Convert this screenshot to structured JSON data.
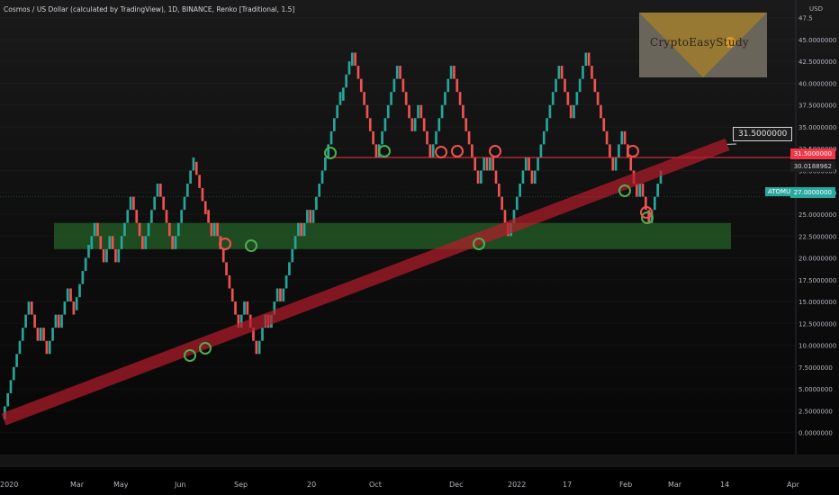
{
  "header": {
    "title": "Cosmos / US Dollar (calculated by TradingView), 1D, BINANCE, Renko [Traditional, 1.5]"
  },
  "logo": {
    "text": "CryptoEasyStudy"
  },
  "axis": {
    "currency": "USD"
  },
  "badges": {
    "level_price": "31.5000000",
    "last_price": "30.0188962",
    "symbol": "ATOMUSD",
    "symbol_price": "27.0000000"
  },
  "callout": {
    "text": "31.5000000"
  },
  "colors": {
    "up": "#26a69a",
    "down": "#ef5350",
    "zone": "#2e7d32",
    "trendline": "#b71c2b",
    "level": "#f23645",
    "circle_green": "#4caf50",
    "circle_red": "#ef5350"
  },
  "chart_data": {
    "type": "renko",
    "symbol": "ATOMUSD",
    "box_size": 1.5,
    "y_ticks": [
      0,
      2.5,
      5,
      7.5,
      10,
      12.5,
      15,
      17.5,
      20,
      22.5,
      25,
      27.5,
      30,
      32.5,
      35,
      37.5,
      40,
      42.5,
      45,
      47.5
    ],
    "y_tick_labels": [
      "0.0000000",
      "2.5000000",
      "5.0000000",
      "7.5000000",
      "10.0000000",
      "12.5000000",
      "15.0000000",
      "17.5000000",
      "20.0000000",
      "22.5000000",
      "25.0000000",
      "27.5000000",
      "30.0000000",
      "32.5000000",
      "35.0000000",
      "37.5000000",
      "40.0000000",
      "42.5000000",
      "45.0000000",
      "47.5"
    ],
    "ylim": [
      -2,
      48.5
    ],
    "x_labels": [
      "2020",
      "Mar",
      "May",
      "Jun",
      "Sep",
      "20",
      "Oct",
      "Dec",
      "2022",
      "17",
      "Feb",
      "Mar",
      "14",
      "Apr"
    ],
    "path": [
      1.5,
      15,
      10.5,
      12,
      9,
      13.5,
      12,
      16.5,
      14,
      21,
      22.5,
      24,
      19.5,
      21,
      22.5,
      19.5,
      24,
      27,
      25.5,
      21,
      22.5,
      27,
      28.5,
      25.5,
      21,
      22.5,
      28.5,
      31,
      25.5,
      22.5,
      24,
      18,
      16.5,
      13.5,
      12,
      15,
      10.5,
      9,
      10.5,
      13.5,
      12,
      16.5,
      15,
      19.5,
      21,
      24,
      22.5,
      25.5,
      24,
      28.5,
      33,
      36,
      38,
      42,
      43.5,
      40.5,
      36,
      31.5,
      36,
      40.5,
      42,
      40.5,
      37.5,
      34.5,
      37.5,
      33,
      31.5,
      37.5,
      42,
      40.5,
      36,
      33,
      30,
      28.5,
      31.5,
      30,
      31.5,
      28.5,
      24,
      22.5,
      24,
      27,
      30,
      31.5,
      30,
      28.5,
      34.5,
      37.5,
      40.5,
      42,
      39,
      36,
      40.5,
      43.5,
      40.5,
      37.5,
      33,
      31.5,
      30,
      34.5,
      33,
      31.5,
      30,
      27,
      28.5,
      24,
      25.5,
      28.5,
      30
    ],
    "support_zone": {
      "low": 21,
      "high": 24
    },
    "horizontal_level": 31.5,
    "trendline": {
      "from_label": "2020",
      "to_label": "14",
      "from_value": 1.5,
      "to_value": 33
    }
  }
}
